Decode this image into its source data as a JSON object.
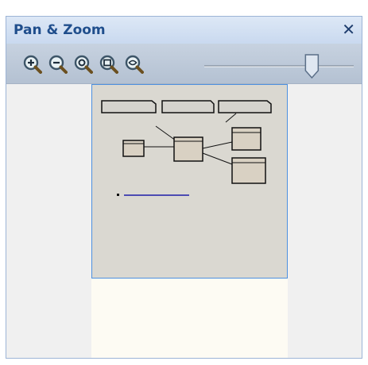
{
  "panel": {
    "title": "Pan & Zoom",
    "close_glyph": "✕"
  },
  "toolbar": {
    "buttons": [
      {
        "name": "zoom-in-icon"
      },
      {
        "name": "zoom-out-icon"
      },
      {
        "name": "zoom-actual-icon"
      },
      {
        "name": "zoom-fit-icon"
      },
      {
        "name": "zoom-custom-icon"
      }
    ],
    "zoom_slider_level": 0.72
  },
  "colors": {
    "title_text": "#1f4e8c",
    "viewport_border": "#4d90e0",
    "connector_line": "#1c1ca8"
  }
}
